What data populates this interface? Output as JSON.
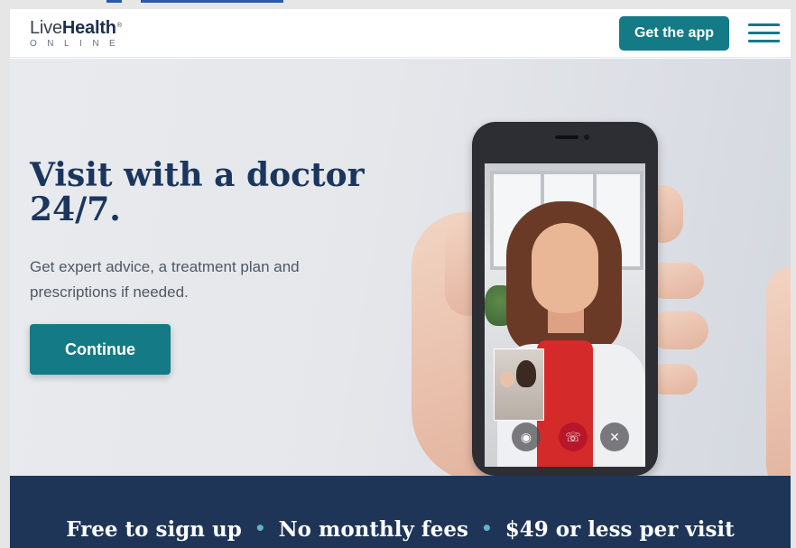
{
  "header": {
    "logo": {
      "part1": "Live",
      "part2": "Health",
      "mark": "®",
      "sub": "ONLINE"
    },
    "get_app_label": "Get the app",
    "menu_icon": "hamburger-menu-icon"
  },
  "hero": {
    "headline": "Visit with a doctor 24/7.",
    "subtext": "Get expert advice, a treatment plan and prescriptions if needed.",
    "continue_label": "Continue"
  },
  "phone": {
    "controls": [
      "camera-icon",
      "end-call-icon",
      "mute-icon"
    ]
  },
  "banner": {
    "items": [
      "Free to sign up",
      "No monthly fees",
      "$49 or less per visit"
    ],
    "separator": "•"
  },
  "colors": {
    "accent": "#137a86",
    "navy": "#1b365d",
    "banner_bg": "#1e3557",
    "separator": "#5fb4c8"
  }
}
